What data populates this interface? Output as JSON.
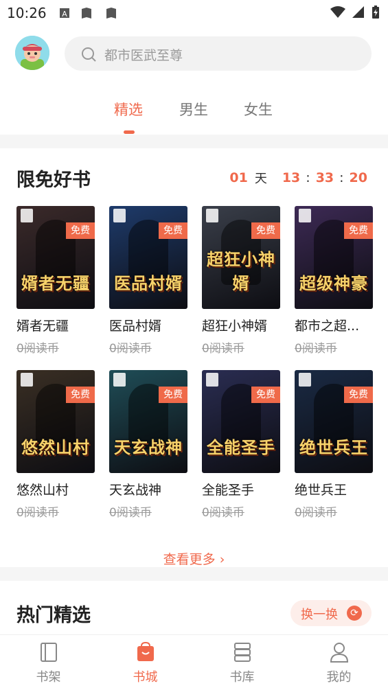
{
  "status_bar": {
    "time": "10:26"
  },
  "search": {
    "placeholder": "都市医武至尊"
  },
  "tabs": [
    {
      "label": "精选",
      "active": true
    },
    {
      "label": "男生",
      "active": false
    },
    {
      "label": "女生",
      "active": false
    }
  ],
  "free_section": {
    "title": "限免好书",
    "countdown": {
      "days": "01",
      "day_unit": "天",
      "hours": "13",
      "minutes": "33",
      "seconds": "20"
    },
    "badge": "免费",
    "books": [
      {
        "title": "婿者无疆",
        "cover_text": "婿者无疆",
        "price": "0阅读币",
        "color": "#3b2a2a"
      },
      {
        "title": "医品村婿",
        "cover_text": "医品村婿",
        "price": "0阅读币",
        "color": "#1e3b6b"
      },
      {
        "title": "超狂小神婿",
        "cover_text": "超狂小神婿",
        "price": "0阅读币",
        "color": "#3a3f4a"
      },
      {
        "title": "都市之超...",
        "cover_text": "超级神豪",
        "price": "0阅读币",
        "color": "#3d2a55"
      },
      {
        "title": "悠然山村",
        "cover_text": "悠然山村",
        "price": "0阅读币",
        "color": "#3a2f24"
      },
      {
        "title": "天玄战神",
        "cover_text": "天玄战神",
        "price": "0阅读币",
        "color": "#1f4d57"
      },
      {
        "title": "全能圣手",
        "cover_text": "全能圣手",
        "price": "0阅读币",
        "color": "#2a2d52"
      },
      {
        "title": "绝世兵王",
        "cover_text": "绝世兵王",
        "price": "0阅读币",
        "color": "#1a2a44"
      }
    ],
    "more_label": "查看更多 ›"
  },
  "hot_section": {
    "title": "热门精选",
    "swap_label": "换一换",
    "swap_icon": "⟳"
  },
  "bottom_nav": [
    {
      "label": "书架",
      "icon": "bookshelf-icon",
      "active": false
    },
    {
      "label": "书城",
      "icon": "bookstore-icon",
      "active": true
    },
    {
      "label": "书库",
      "icon": "library-icon",
      "active": false
    },
    {
      "label": "我的",
      "icon": "profile-icon",
      "active": false
    }
  ],
  "colors": {
    "accent": "#f0694c",
    "badge": "#ef6a4a"
  }
}
